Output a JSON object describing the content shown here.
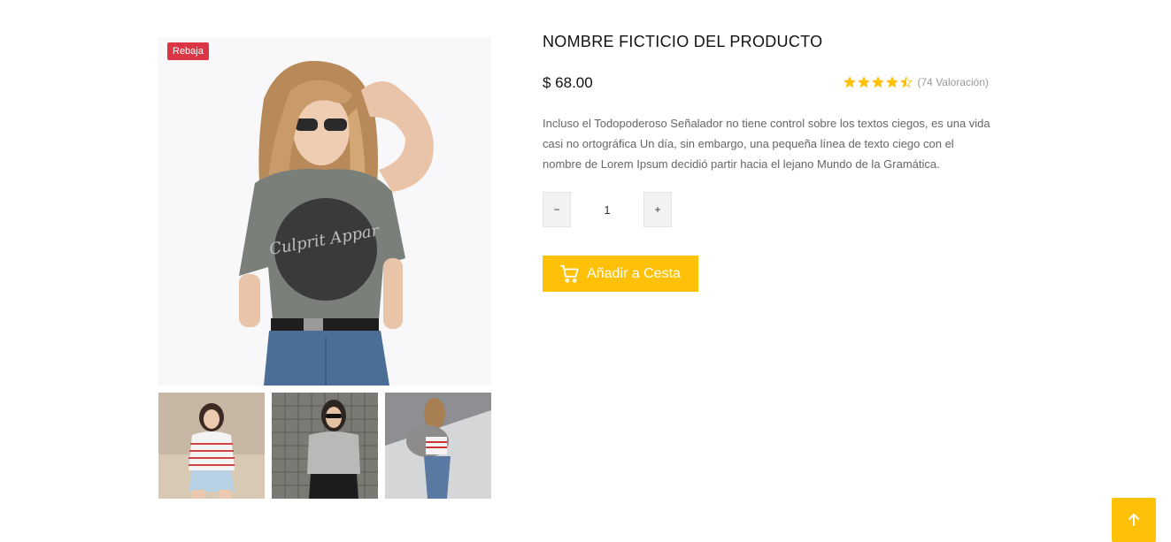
{
  "product": {
    "title": "NOMBRE FICTICIO DEL PRODUCTO",
    "badge": "Rebaja",
    "price": "$ 68.00",
    "rating": {
      "value": 4.5,
      "max": 5,
      "count_label": "(74 Valoración)"
    },
    "description": "Incluso el Todopoderoso Señalador no tiene control sobre los textos ciegos, es una vida casi no ortográfica Un día, sin embargo, una pequeña línea de texto ciego con el nombre de Lorem Ipsum decidió partir hacia el lejano Mundo de la Gramática.",
    "main_image_text": "Culprit Appar"
  },
  "quantity": {
    "value": "1",
    "minus_label": "−",
    "plus_label": "+"
  },
  "cart": {
    "label": "Añadir a Cesta",
    "icon": "cart-icon"
  },
  "back_to_top": {
    "icon": "arrow-up-icon"
  },
  "colors": {
    "accent": "#ffc107",
    "badge": "#dc3545",
    "star": "#ffc107"
  }
}
